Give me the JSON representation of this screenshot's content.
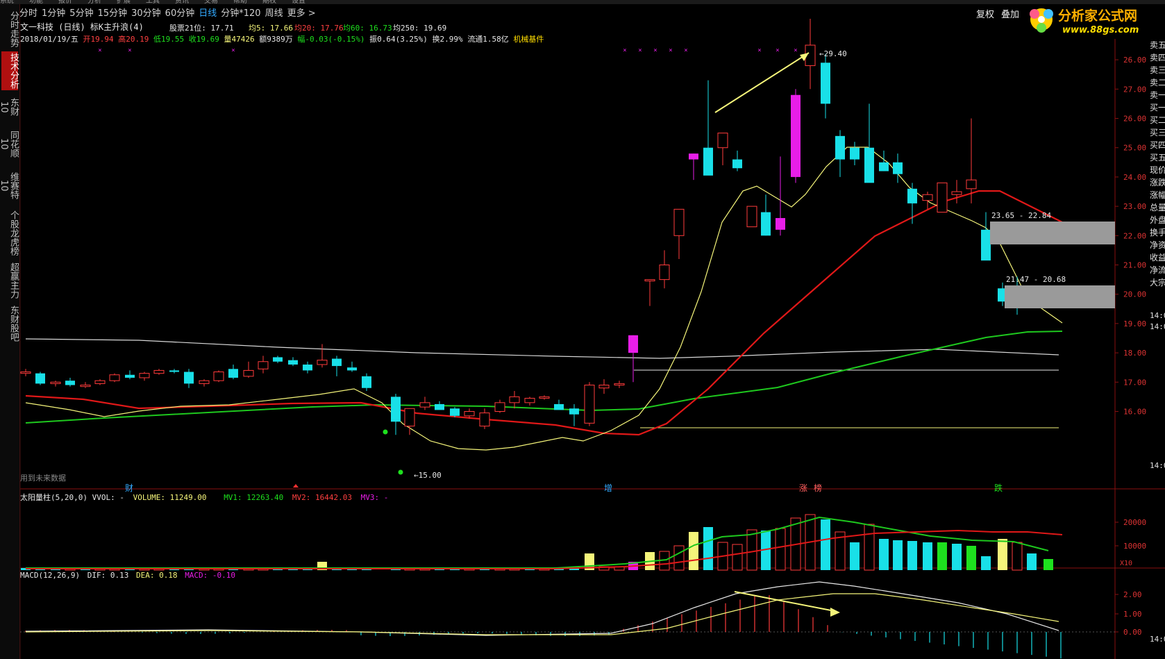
{
  "menubar": {
    "items": [
      "系统",
      "功能",
      "报价",
      "分析",
      "扩展",
      "工具",
      "资讯",
      "交易",
      "帮助",
      "期权",
      "设置"
    ]
  },
  "leftbar": {
    "tabs": [
      {
        "label": "分时走势",
        "active": false
      },
      {
        "label": "技术分析",
        "active": true
      },
      {
        "label": "东财10",
        "active": false
      },
      {
        "label": "同花顺10",
        "active": false
      },
      {
        "label": "维赛特10",
        "active": false
      },
      {
        "label": "个股龙虎榜",
        "active": false
      },
      {
        "label": "超赢主力",
        "active": false
      },
      {
        "label": "东财股吧",
        "active": false
      }
    ]
  },
  "toolbar": {
    "periods": [
      "分时",
      "1分钟",
      "5分钟",
      "15分钟",
      "30分钟",
      "60分钟",
      "日线",
      "分钟*120",
      "周线",
      "更多 >"
    ],
    "active_period": "日线",
    "restore_label": "复权",
    "overlay_label": "叠加"
  },
  "logo": {
    "title": "分析家公式网",
    "url_text": "www.88gs.com"
  },
  "header": {
    "title": "文一科技 (日线) 标K主升浪(4)",
    "rank_label": "股票21位: 17.71",
    "ma5": "均5: 17.66",
    "ma20": "均20: 17.76",
    "ma60": "均60: 16.73",
    "ma250": "均250: 19.69",
    "date": "2018/01/19/五",
    "open": "开19.94",
    "high": "高20.19",
    "low": "低19.55",
    "close": "收19.69",
    "volume": "量47426",
    "amount": "额9389万",
    "change": "幅-0.03(-0.15%)",
    "amplitude": "振0.64(3.25%)",
    "turnover": "换2.99%",
    "float": "流通1.58亿",
    "sector": "机械基件"
  },
  "price_axis": [
    "26.00",
    "27.00",
    "26.00",
    "25.00",
    "24.00",
    "23.00",
    "22.00",
    "21.00",
    "20.00",
    "19.00",
    "18.00",
    "17.00",
    "16.00"
  ],
  "annotations": {
    "high_label": "←29.40",
    "low_label": "←15.00",
    "zone1": "23.65 - 22.84",
    "zone2": "21.47 - 20.68",
    "future_note": "用到未来数据",
    "events": [
      "财",
      "增",
      "涨",
      "榜",
      "跌"
    ]
  },
  "orderbook": [
    "卖五",
    "卖四",
    "卖三",
    "卖二",
    "卖一",
    "买一",
    "买二",
    "买三",
    "买四",
    "买五",
    "现价",
    "涨跌",
    "涨幅",
    "总量",
    "外盘",
    "换手",
    "净资",
    "收益",
    "净流",
    "大宗"
  ],
  "right_times": [
    "14:0",
    "14:0",
    "14:0",
    "14:0"
  ],
  "volume_panel": {
    "title": "太阳量柱(5,20,0) VVOL: -",
    "volume": "VOLUME: 11249.00",
    "mv1": "MV1: 12263.40",
    "mv2": "MV2: 16442.03",
    "mv3": "MV3: -",
    "axis": [
      "20000",
      "10000"
    ],
    "unit": "X10"
  },
  "macd_panel": {
    "title": "MACD(12,26,9)",
    "dif": "DIF: 0.13",
    "dea": "DEA: 0.18",
    "macd": "MACD: -0.10",
    "axis": [
      "2.00",
      "1.00",
      "0.00"
    ]
  },
  "colors": {
    "up": "#ff3b3b",
    "down": "#19e0e8",
    "ma5": "#f5f57a",
    "ma20": "#e01818",
    "ma60": "#1ec81e",
    "magenta": "#e81ee8",
    "zone": "#9a9a9a"
  }
}
